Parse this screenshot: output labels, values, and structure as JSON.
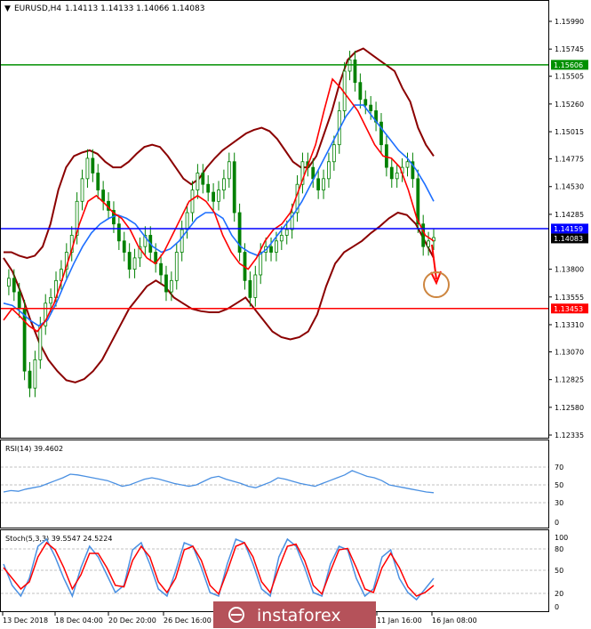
{
  "header": {
    "symbol": "EURUSD,H4",
    "ohlc": "1.14113 1.14133 1.14066 1.14083"
  },
  "colors": {
    "candle": "#008000",
    "upper_band": "#8b0000",
    "ma_fast": "#ff0000",
    "ma_slow": "#1e6fff",
    "support_line": "#ff0000",
    "resistance_line": "#009000",
    "mid_line": "#0000ff",
    "rsi": "#4a90e2",
    "stoch_main": "#4a90e2",
    "stoch_signal": "#ff0000",
    "arrow": "#ff0000",
    "target_circle": "#cd853f"
  },
  "levels": {
    "resistance": {
      "value": 1.15606,
      "label": "1.15606"
    },
    "mid": {
      "value": 1.14159,
      "label": "1.14159"
    },
    "current": {
      "value": 1.14083,
      "label": "1.14083"
    },
    "support": {
      "value": 1.13453,
      "label": "1.13453"
    }
  },
  "rsi_panel": {
    "title": "RSI(14) 39.4602",
    "ticks": [
      "70",
      "50",
      "30",
      "0"
    ]
  },
  "stoch_panel": {
    "title": "Stoch(5,3,3) 39.5547 24.5224",
    "ticks": [
      "100",
      "80",
      "50",
      "20",
      "0"
    ]
  },
  "x_axis": [
    "13 Dec 2018",
    "18 Dec 04:00",
    "20 Dec 20:00",
    "26 Dec 16:00",
    "11 Jan 16:00",
    "16 Jan 08:00"
  ],
  "watermark": "instaforex",
  "chart_data": {
    "type": "line",
    "title": "EURUSD,H4",
    "ylim": [
      1.12335,
      1.1599
    ],
    "y_ticks": [
      1.1599,
      1.15745,
      1.15505,
      1.1526,
      1.15015,
      1.14775,
      1.1453,
      1.14285,
      1.138,
      1.13555,
      1.1331,
      1.1307,
      1.12825,
      1.1258,
      1.12335
    ],
    "y_tick_labels": [
      "1.15990",
      "1.15745",
      "1.15505",
      "1.15260",
      "1.15015",
      "1.14775",
      "1.14530",
      "1.14285",
      "1.13800",
      "1.13555",
      "1.13310",
      "1.13070",
      "1.12825",
      "1.12580",
      "1.12335"
    ],
    "x_labels": [
      "13 Dec 2018",
      "18 Dec 04:00",
      "20 Dec 20:00",
      "26 Dec 16:00",
      "11 Jan 16:00",
      "16 Jan 08:00"
    ],
    "price": [
      1.1365,
      1.1372,
      1.136,
      1.1345,
      1.129,
      1.1275,
      1.13,
      1.133,
      1.135,
      1.1355,
      1.137,
      1.138,
      1.1395,
      1.141,
      1.144,
      1.146,
      1.1478,
      1.1465,
      1.145,
      1.144,
      1.1432,
      1.142,
      1.1405,
      1.1395,
      1.138,
      1.139,
      1.14,
      1.141,
      1.1395,
      1.1385,
      1.1375,
      1.136,
      1.137,
      1.1395,
      1.1415,
      1.143,
      1.145,
      1.1465,
      1.1455,
      1.1448,
      1.144,
      1.145,
      1.146,
      1.1475,
      1.143,
      1.1395,
      1.137,
      1.1355,
      1.1375,
      1.1395,
      1.14,
      1.1395,
      1.1405,
      1.141,
      1.1415,
      1.143,
      1.1455,
      1.1475,
      1.147,
      1.146,
      1.145,
      1.146,
      1.1475,
      1.149,
      1.152,
      1.1555,
      1.1565,
      1.1545,
      1.153,
      1.1525,
      1.152,
      1.151,
      1.149,
      1.147,
      1.146,
      1.1465,
      1.147,
      1.1475,
      1.146,
      1.142,
      1.14,
      1.1405,
      1.1408
    ],
    "bb_upper": [
      1.1395,
      1.1395,
      1.1392,
      1.139,
      1.1392,
      1.14,
      1.142,
      1.145,
      1.147,
      1.148,
      1.1483,
      1.1485,
      1.1482,
      1.1475,
      1.147,
      1.147,
      1.1475,
      1.1482,
      1.1488,
      1.149,
      1.1488,
      1.148,
      1.147,
      1.146,
      1.1455,
      1.146,
      1.147,
      1.1478,
      1.1485,
      1.149,
      1.1495,
      1.15,
      1.1503,
      1.1505,
      1.1502,
      1.1495,
      1.1485,
      1.1475,
      1.147,
      1.147,
      1.148,
      1.15,
      1.152,
      1.1545,
      1.1565,
      1.1572,
      1.1575,
      1.157,
      1.1565,
      1.156,
      1.1555,
      1.154,
      1.1528,
      1.1505,
      1.149,
      1.148
    ],
    "bb_lower": [
      1.139,
      1.1378,
      1.1358,
      1.1335,
      1.1315,
      1.13,
      1.129,
      1.1282,
      1.128,
      1.1283,
      1.129,
      1.13,
      1.1315,
      1.133,
      1.1345,
      1.1355,
      1.1365,
      1.137,
      1.1365,
      1.1355,
      1.135,
      1.1345,
      1.1343,
      1.1342,
      1.1342,
      1.1345,
      1.135,
      1.1355,
      1.1345,
      1.1335,
      1.1325,
      1.132,
      1.1318,
      1.132,
      1.1325,
      1.134,
      1.1365,
      1.1385,
      1.1395,
      1.14,
      1.1405,
      1.1412,
      1.1418,
      1.1425,
      1.143,
      1.1428,
      1.142,
      1.1405,
      1.139
    ],
    "series": [
      {
        "values": [
          1.1335,
          1.1345,
          1.1338,
          1.133,
          1.1325,
          1.1335,
          1.135,
          1.1372,
          1.1395,
          1.142,
          1.144,
          1.1445,
          1.1438,
          1.143,
          1.1425,
          1.1415,
          1.14,
          1.139,
          1.1385,
          1.1395,
          1.141,
          1.1425,
          1.144,
          1.1445,
          1.144,
          1.143,
          1.141,
          1.1395,
          1.1385,
          1.138,
          1.139,
          1.1405,
          1.1415,
          1.142,
          1.143,
          1.145,
          1.147,
          1.149,
          1.152,
          1.1548,
          1.154,
          1.153,
          1.152,
          1.1505,
          1.149,
          1.148,
          1.1478,
          1.147,
          1.145,
          1.1425,
          1.141,
          1.1405
        ]
      },
      {
        "values": [
          1.135,
          1.1348,
          1.1342,
          1.1335,
          1.133,
          1.1335,
          1.135,
          1.1368,
          1.1385,
          1.14,
          1.1412,
          1.142,
          1.1425,
          1.1428,
          1.1425,
          1.142,
          1.141,
          1.14,
          1.1395,
          1.1398,
          1.1405,
          1.1415,
          1.1425,
          1.143,
          1.143,
          1.1425,
          1.141,
          1.14,
          1.1395,
          1.1392,
          1.1398,
          1.1408,
          1.1418,
          1.1428,
          1.144,
          1.1455,
          1.147,
          1.1485,
          1.15,
          1.1515,
          1.1525,
          1.1525,
          1.1515,
          1.1505,
          1.1495,
          1.1485,
          1.1478,
          1.1468,
          1.1455,
          1.144
        ]
      }
    ],
    "rsi": [
      40,
      42,
      41,
      44,
      46,
      48,
      52,
      56,
      60,
      65,
      64,
      62,
      60,
      58,
      56,
      52,
      48,
      50,
      54,
      58,
      60,
      58,
      55,
      52,
      50,
      48,
      50,
      55,
      60,
      62,
      58,
      55,
      52,
      48,
      46,
      50,
      54,
      60,
      58,
      55,
      52,
      50,
      48,
      52,
      56,
      60,
      64,
      70,
      66,
      62,
      60,
      56,
      50,
      48,
      46,
      44,
      42,
      40,
      39
    ],
    "stoch_k": [
      60,
      30,
      15,
      40,
      85,
      95,
      70,
      40,
      15,
      55,
      85,
      70,
      45,
      20,
      30,
      80,
      90,
      60,
      25,
      15,
      50,
      90,
      85,
      55,
      20,
      15,
      60,
      95,
      90,
      60,
      25,
      15,
      70,
      95,
      85,
      55,
      20,
      15,
      60,
      85,
      80,
      40,
      15,
      25,
      70,
      80,
      40,
      20,
      10,
      25,
      40
    ],
    "stoch_d": [
      55,
      40,
      25,
      35,
      70,
      90,
      80,
      55,
      25,
      45,
      75,
      75,
      55,
      30,
      28,
      65,
      85,
      70,
      35,
      20,
      40,
      80,
      85,
      65,
      30,
      18,
      50,
      85,
      90,
      70,
      35,
      20,
      55,
      85,
      88,
      65,
      30,
      18,
      50,
      80,
      82,
      55,
      25,
      20,
      55,
      75,
      55,
      28,
      15,
      20,
      30
    ]
  }
}
